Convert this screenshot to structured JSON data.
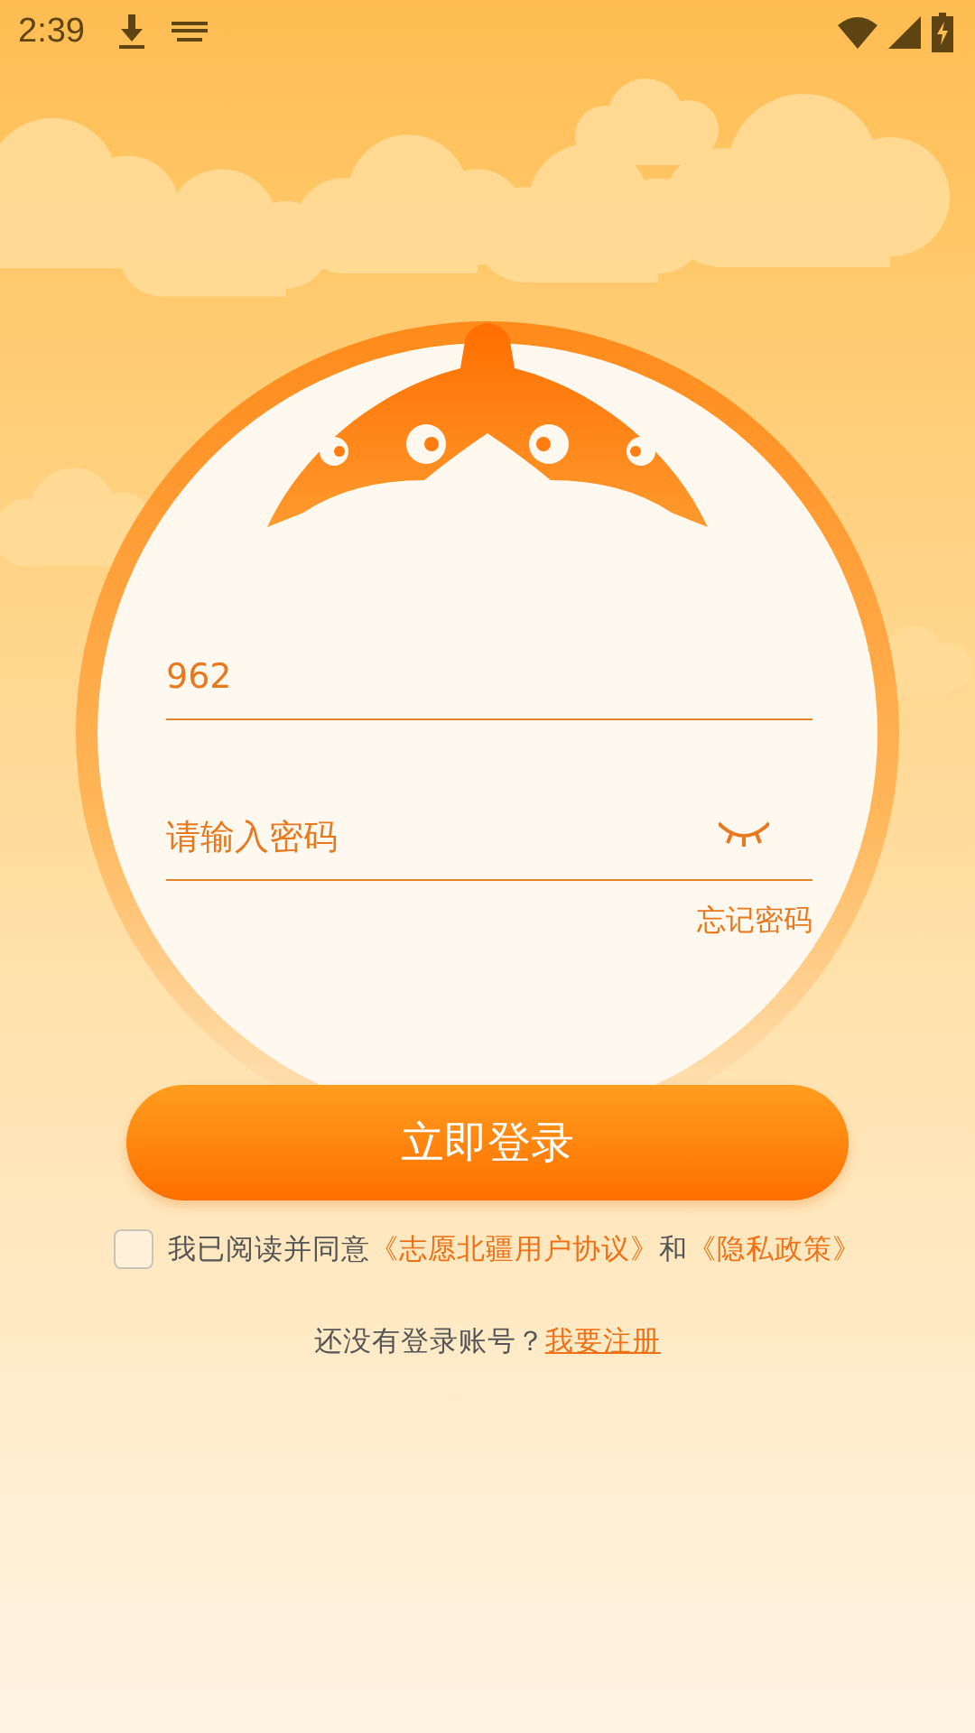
{
  "status_bar": {
    "time": "2:39"
  },
  "login_form": {
    "username": {
      "value": "962"
    },
    "password": {
      "placeholder": "请输入密码",
      "visible": false
    },
    "forgot_link": "忘记密码",
    "submit_button": "立即登录"
  },
  "agreement": {
    "checked": false,
    "parts": [
      {
        "kind": "text",
        "text": "我已阅读并同意"
      },
      {
        "kind": "link",
        "text": "《志愿北疆用户协议》"
      },
      {
        "kind": "text",
        "text": "和"
      },
      {
        "kind": "link",
        "text": "《隐私政策》"
      }
    ]
  },
  "register": {
    "prompt": "还没有登录账号？",
    "link": "我要注册"
  }
}
